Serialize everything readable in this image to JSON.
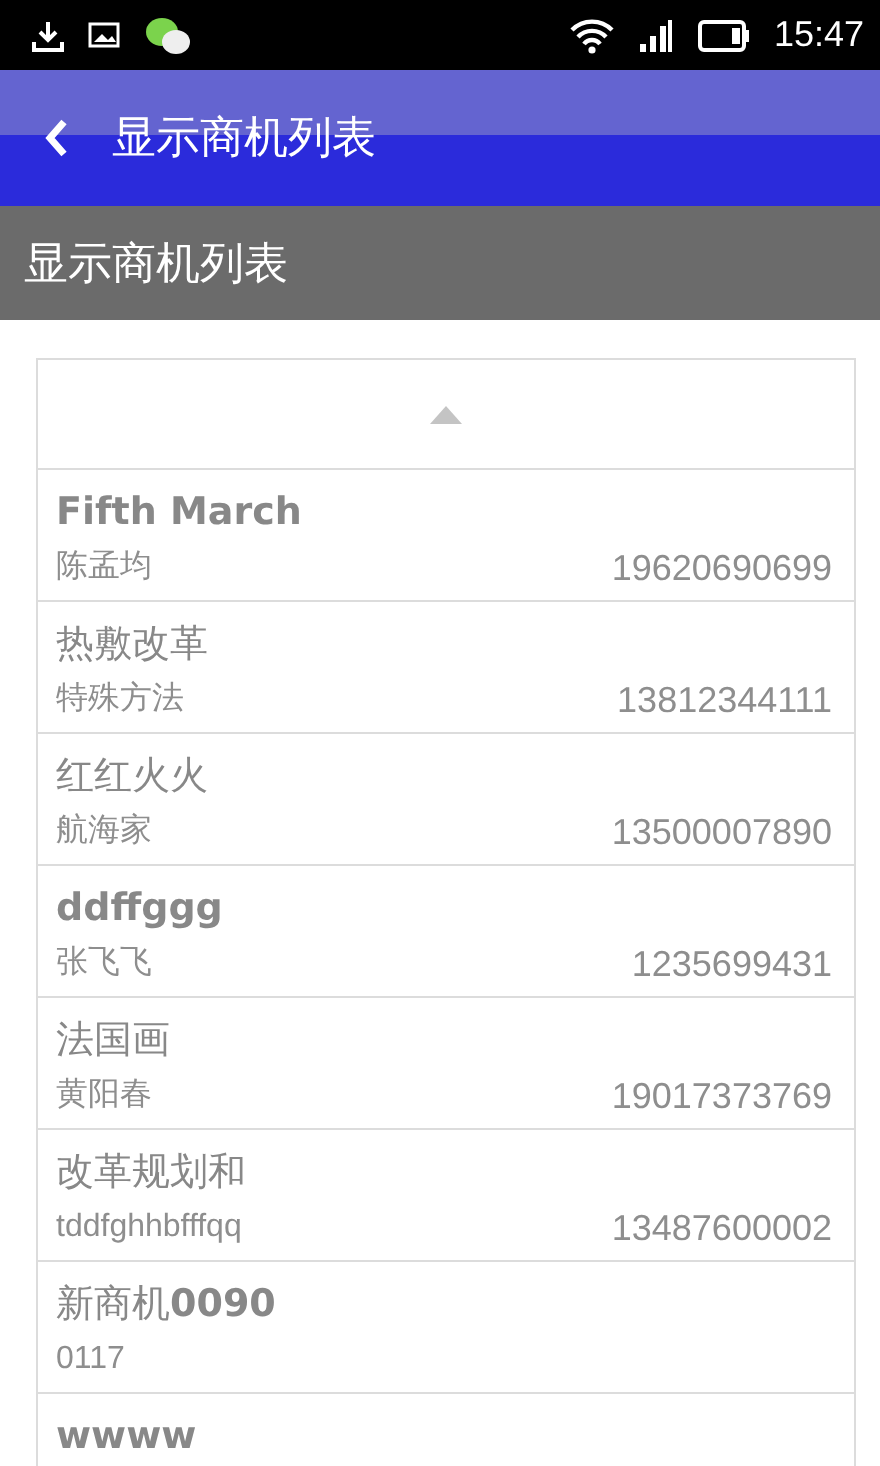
{
  "status_bar": {
    "time": "15:47"
  },
  "app_bar": {
    "title": "显示商机列表"
  },
  "section_header": {
    "title": "显示商机列表"
  },
  "items": [
    {
      "title": "Fifth March",
      "bold": true,
      "contact": "陈孟均",
      "phone": "19620690699"
    },
    {
      "title": "热敷改革",
      "bold": false,
      "contact": "特殊方法",
      "phone": "13812344111"
    },
    {
      "title": "红红火火",
      "bold": false,
      "contact": "航海家",
      "phone": "13500007890"
    },
    {
      "title": "ddffggg",
      "bold": true,
      "contact": "张飞飞",
      "phone": "1235699431"
    },
    {
      "title": "法国画",
      "bold": false,
      "contact": "黄阳春",
      "phone": "19017373769"
    },
    {
      "title": "改革规划和",
      "bold": false,
      "contact": "tddfghhbfffqq",
      "phone": "13487600002"
    },
    {
      "title": "新商机**0090**",
      "bold": false,
      "contact": "0117"
    },
    {
      "title": "wwww",
      "bold": true
    }
  ]
}
